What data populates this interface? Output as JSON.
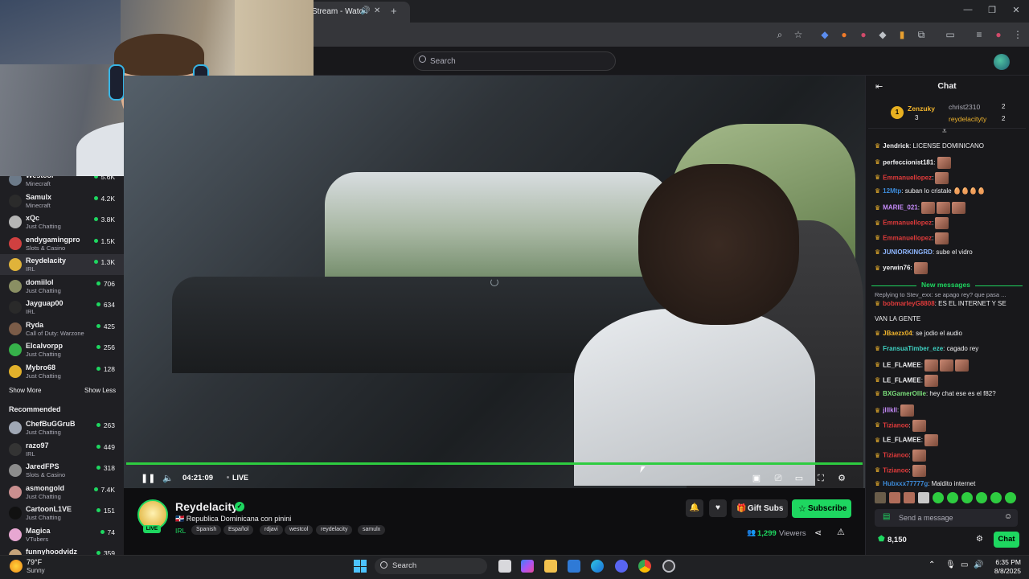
{
  "browser": {
    "tab_title": "Stream - Watch",
    "new_tab": "+",
    "window_controls": [
      "—",
      "❐",
      "✕"
    ]
  },
  "twitch": {
    "search_placeholder": "Search"
  },
  "sidebar": {
    "channels": [
      {
        "name": "Westcol",
        "category": "Minecraft",
        "viewers": "5.6K",
        "color": "#6c7a89"
      },
      {
        "name": "Samulx",
        "category": "Minecraft",
        "viewers": "4.2K",
        "color": "#2b2b2b"
      },
      {
        "name": "xQc",
        "category": "Just Chatting",
        "viewers": "3.8K",
        "color": "#b5b5b5"
      },
      {
        "name": "endygamingpro",
        "category": "Slots & Casino",
        "viewers": "1.5K",
        "color": "#d04040"
      },
      {
        "name": "Reydelacity",
        "category": "IRL",
        "viewers": "1.3K",
        "color": "#e0b33a"
      },
      {
        "name": "domiilol",
        "category": "Just Chatting",
        "viewers": "706",
        "color": "#8a8f63"
      },
      {
        "name": "Jayguap00",
        "category": "IRL",
        "viewers": "634",
        "color": "#2a2a2a"
      },
      {
        "name": "Ryda",
        "category": "Call of Duty: Warzone",
        "viewers": "425",
        "color": "#7b5c48"
      },
      {
        "name": "Elcalvorpp",
        "category": "Just Chatting",
        "viewers": "256",
        "color": "#36b24a"
      },
      {
        "name": "Mybro68",
        "category": "Just Chatting",
        "viewers": "128",
        "color": "#e2b12b"
      }
    ],
    "show_more": "Show More",
    "show_less": "Show Less",
    "recommended_title": "Recommended",
    "recommended": [
      {
        "name": "ChefBuGGruB",
        "category": "Just Chatting",
        "viewers": "263",
        "color": "#a0a8b5"
      },
      {
        "name": "razo97",
        "category": "IRL",
        "viewers": "449",
        "color": "#343434"
      },
      {
        "name": "JaredFPS",
        "category": "Slots & Casino",
        "viewers": "318",
        "color": "#8c8c8c"
      },
      {
        "name": "asmongold",
        "category": "Just Chatting",
        "viewers": "7.4K",
        "color": "#c98f8f"
      },
      {
        "name": "CartoonL1VE",
        "category": "Just Chatting",
        "viewers": "151",
        "color": "#111111"
      },
      {
        "name": "Magica",
        "category": "VTubers",
        "viewers": "74",
        "color": "#e7a7d2"
      },
      {
        "name": "funnyhoodvidz",
        "category": "",
        "viewers": "359",
        "color": "#c7a47b"
      }
    ]
  },
  "player": {
    "time": "04:21:09",
    "live_label": "LIVE"
  },
  "stream": {
    "name": "Reydelacity",
    "title": "🇩🇴 Republica Dominicana con pinini",
    "category": "IRL",
    "tags": [
      "Spanish",
      "Español",
      "rdjavi",
      "westcol",
      "reydelacity",
      "samulx"
    ],
    "gift_subs": "Gift Subs",
    "subscribe": "Subscribe",
    "viewers": "1,299",
    "viewers_label": "Viewers",
    "live_badge": "LIVE"
  },
  "chat": {
    "title": "Chat",
    "leaderboard": {
      "rank": "1",
      "first": {
        "name": "Zenzuky",
        "count": "3"
      },
      "second": {
        "name": "christ2310",
        "count": "2"
      },
      "third": {
        "name": "reydelacityty",
        "count": "2"
      }
    },
    "messages_before": [
      {
        "user": "Jendrick",
        "color": "#efeff1",
        "text": ": LICENSE DOMINICANO"
      },
      {
        "user": "perfeccionist181",
        "color": "#efeff1",
        "text": ":"
      },
      {
        "user": "Emmanuellopez",
        "color": "#e23b3b",
        "text": ":"
      },
      {
        "user": "12Mtp",
        "color": "#3d8bd9",
        "text": ": suban lo cristale 🥚🥚🥚🥚"
      },
      {
        "user": "MARIE_021",
        "color": "#c58af9",
        "text": ":"
      },
      {
        "user": "Emmanuellopez",
        "color": "#e23b3b",
        "text": ":"
      },
      {
        "user": "Emmanuellopez",
        "color": "#e23b3b",
        "text": ":"
      },
      {
        "user": "JUNIORKINGRD",
        "color": "#8fb7ff",
        "text": ": sube el vidro"
      },
      {
        "user": "yerwin76",
        "color": "#efeff1",
        "text": ":"
      }
    ],
    "new_messages_label": "New messages",
    "reply_hint": "Replying to Stev_exx: se apago rey? que pasa ...",
    "messages_after": [
      {
        "user": "bobmarleyG8808",
        "color": "#e23b3b",
        "text": ": ES EL INTERNET Y SE"
      },
      {
        "user": "",
        "color": "#efeff1",
        "text": "VAN LA GENTE"
      },
      {
        "user": "JBaezx04",
        "color": "#f0b42d",
        "text": ": se jodio el audio"
      },
      {
        "user": "FransuaTimber_eze",
        "color": "#3fd3c4",
        "text": ": cagado rey"
      },
      {
        "user": "LE_FLAMEE",
        "color": "#efeff1",
        "text": ":"
      },
      {
        "user": "LE_FLAMEE",
        "color": "#efeff1",
        "text": ":"
      },
      {
        "user": "BXGamerOllie",
        "color": "#7be07b",
        "text": ": hey chat ese es el f82?"
      },
      {
        "user": "jlllkll",
        "color": "#c58af9",
        "text": ":"
      },
      {
        "user": "Tizianoo",
        "color": "#e23b3b",
        "text": ":"
      },
      {
        "user": "LE_FLAMEE",
        "color": "#efeff1",
        "text": ":"
      },
      {
        "user": "Tizianoo",
        "color": "#e23b3b",
        "text": ":"
      },
      {
        "user": "Tizianoo",
        "color": "#e23b3b",
        "text": ":"
      },
      {
        "user": "Hubxxx77777g",
        "color": "#3d8bd9",
        "text": ": Maldito internet"
      }
    ],
    "send_placeholder": "Send a message",
    "points": "8,150",
    "chat_button": "Chat"
  },
  "taskbar": {
    "temp": "79°F",
    "weather": "Sunny",
    "search": "Search",
    "time": "6:35 PM",
    "date": "8/8/2025"
  }
}
